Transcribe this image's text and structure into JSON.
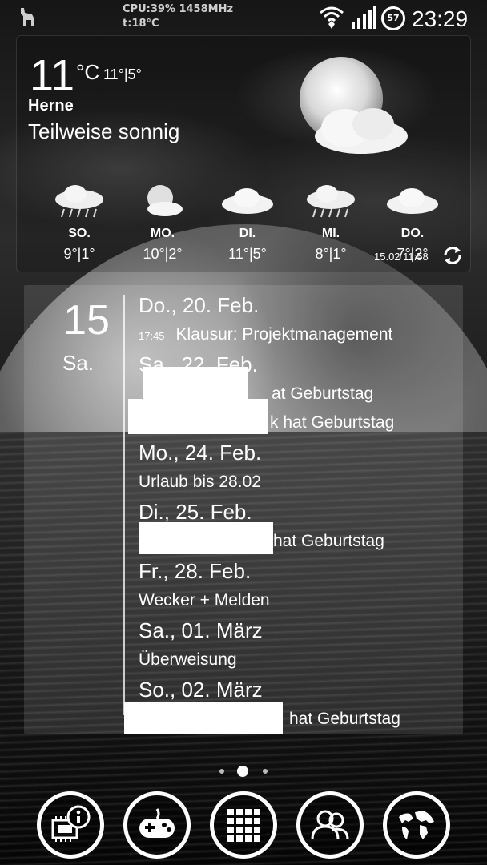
{
  "status_bar": {
    "cpu": "CPU:39% 1458MHz",
    "temp": "t:18°C",
    "battery": "57",
    "time": "23:29"
  },
  "weather": {
    "temperature": "11",
    "unit": "°C",
    "high_low": "11°|5°",
    "city": "Herne",
    "condition": "Teilweise sonnig",
    "updated": "15.02 11:58",
    "forecast": [
      {
        "day": "SO.",
        "range": "9°|1°",
        "icon": "rain-cloud-icon"
      },
      {
        "day": "MO.",
        "range": "10°|2°",
        "icon": "partly-sunny-icon"
      },
      {
        "day": "DI.",
        "range": "11°|5°",
        "icon": "cloud-icon"
      },
      {
        "day": "MI.",
        "range": "8°|1°",
        "icon": "rain-cloud-icon"
      },
      {
        "day": "DO.",
        "range": "7°|2°",
        "icon": "cloud-icon"
      }
    ]
  },
  "calendar": {
    "day_number": "15",
    "weekday": "Sa.",
    "dates": [
      "Do., 20. Feb.",
      "Sa., 22. Feb.",
      "Mo., 24. Feb.",
      "Di., 25. Feb.",
      "Fr., 28. Feb.",
      "Sa., 01. März",
      "So., 02. März"
    ],
    "events": [
      {
        "time": "17:45",
        "title": "Klausur: Projektmanagement"
      },
      {
        "title": "at Geburtstag"
      },
      {
        "title": "k hat Geburtstag"
      },
      {
        "title": "Urlaub bis 28.02"
      },
      {
        "title": "hat Geburtstag"
      },
      {
        "title": "Wecker + Melden"
      },
      {
        "title": "Überweisung"
      },
      {
        "title": "hat Geburtstag"
      }
    ]
  },
  "dock": [
    {
      "icon": "system-info-icon"
    },
    {
      "icon": "gamepad-icon"
    },
    {
      "icon": "app-drawer-icon"
    },
    {
      "icon": "contacts-icon"
    },
    {
      "icon": "browser-globe-icon"
    }
  ]
}
